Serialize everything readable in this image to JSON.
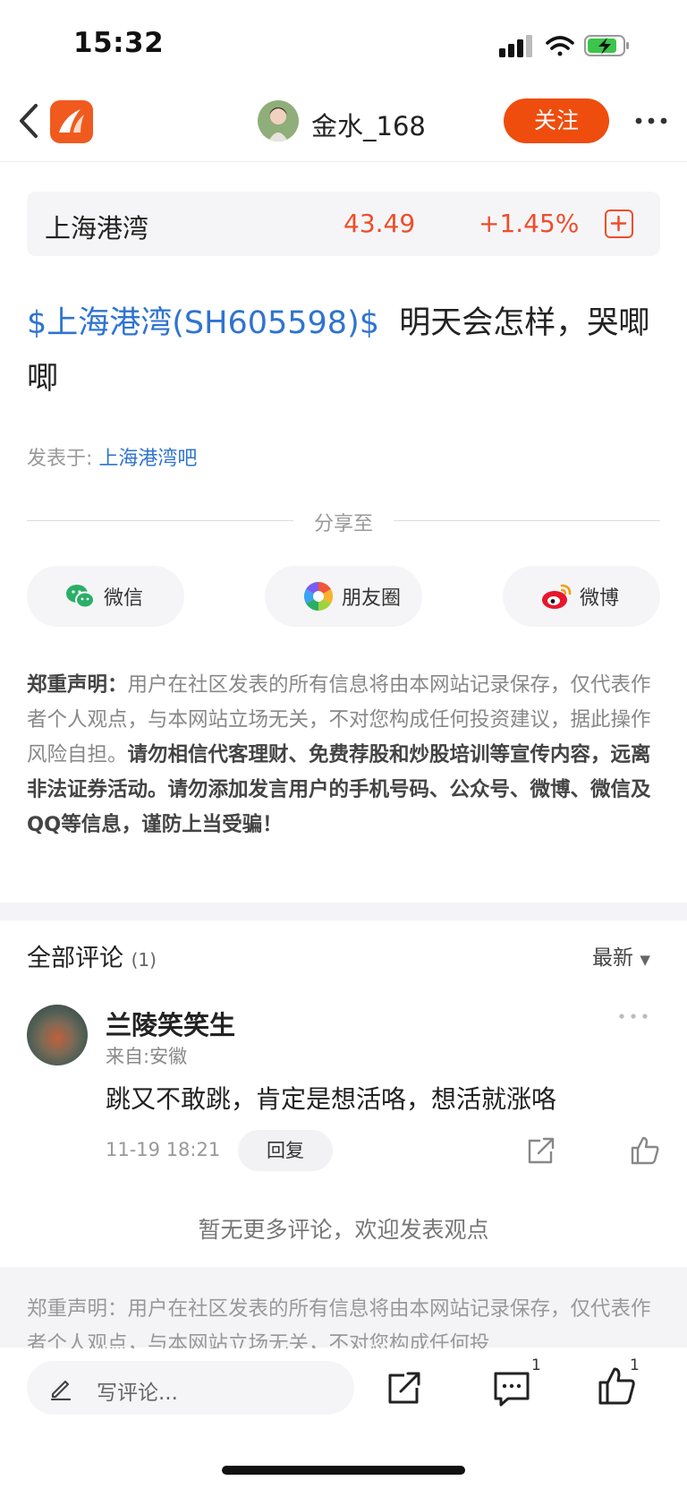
{
  "status_bar": {
    "time": "15:32"
  },
  "nav": {
    "author_name": "金水_168",
    "follow_label": "关注"
  },
  "stock": {
    "name": "上海港湾",
    "price": "43.49",
    "change": "+1.45%"
  },
  "post": {
    "stock_tag": "$上海港湾(SH605598)$",
    "text": "明天会怎样，哭唧唧",
    "posted_in_label": "发表于:",
    "forum": "上海港湾吧"
  },
  "share": {
    "label": "分享至",
    "buttons": [
      {
        "label": "微信"
      },
      {
        "label": "朋友圈"
      },
      {
        "label": "微博"
      }
    ]
  },
  "disclaimer": {
    "head": "郑重声明：",
    "body": "用户在社区发表的所有信息将由本网站记录保存，仅代表作者个人观点，与本网站立场无关，不对您构成任何投资建议，据此操作风险自担。",
    "bold": "请勿相信代客理财、免费荐股和炒股培训等宣传内容，远离非法证券活动。请勿添加发言用户的手机号码、公众号、微博、微信及QQ等信息，谨防上当受骗！"
  },
  "comments": {
    "title": "全部评论",
    "count": "(1)",
    "sort_label": "最新",
    "items": [
      {
        "name": "兰陵笑笑生",
        "from": "来自:安徽",
        "text": "跳又不敢跳，肯定是想活咯，想活就涨咯",
        "time": "11-19 18:21",
        "reply_label": "回复"
      }
    ],
    "no_more": "暂无更多评论，欢迎发表观点"
  },
  "footer_disclaimer": "郑重声明：用户在社区发表的所有信息将由本网站记录保存，仅代表作者个人观点，与本网站立场无关，不对您构成任何投",
  "bottom_bar": {
    "comment_placeholder": "写评论...",
    "comment_count": "1",
    "like_count": "1"
  },
  "colors": {
    "accent": "#ee4d0e",
    "link": "#2f74d0",
    "rise": "#ee4d2b"
  }
}
